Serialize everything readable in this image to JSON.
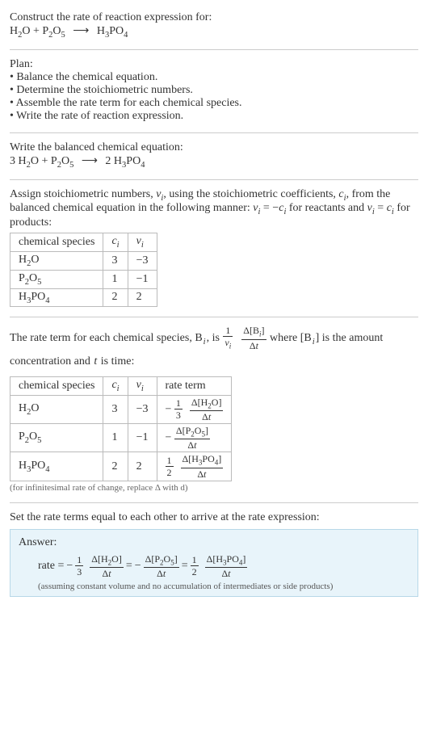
{
  "prompt": {
    "title": "Construct the rate of reaction expression for:",
    "equation_left_a": "H",
    "equation_left_a_sub": "2",
    "equation_left_b": "O + P",
    "equation_left_c_sub": "2",
    "equation_left_d": "O",
    "equation_left_e_sub": "5",
    "arrow": "⟶",
    "equation_right_a": "H",
    "equation_right_a_sub": "3",
    "equation_right_b": "PO",
    "equation_right_b_sub": "4"
  },
  "plan": {
    "heading": "Plan:",
    "items": [
      "• Balance the chemical equation.",
      "• Determine the stoichiometric numbers.",
      "• Assemble the rate term for each chemical species.",
      "• Write the rate of reaction expression."
    ]
  },
  "balanced": {
    "heading": "Write the balanced chemical equation:",
    "c1": "3 ",
    "s1a": "H",
    "s1a_sub": "2",
    "s1b": "O",
    "plus1": " + ",
    "s2a": "P",
    "s2a_sub": "2",
    "s2b": "O",
    "s2b_sub": "5",
    "arrow": "⟶",
    "c2": "2 ",
    "s3a": "H",
    "s3a_sub": "3",
    "s3b": "PO",
    "s3b_sub": "4"
  },
  "stoich": {
    "text_a": "Assign stoichiometric numbers, ",
    "nu": "ν",
    "sub_i": "i",
    "text_b": ", using the stoichiometric coefficients, ",
    "c": "c",
    "text_c": ", from the balanced chemical equation in the following manner: ",
    "rel1_a": "ν",
    "rel1_b": " = −",
    "rel1_c": "c",
    "text_d": " for reactants and ",
    "rel2_a": "ν",
    "rel2_b": " = ",
    "rel2_c": "c",
    "text_e": " for products:",
    "table": {
      "headers": {
        "species": "chemical species",
        "ci": "c",
        "ci_sub": "i",
        "nui": "ν",
        "nui_sub": "i"
      },
      "rows": [
        {
          "sp_a": "H",
          "sp_a_sub": "2",
          "sp_b": "O",
          "ci": "3",
          "nui": "−3"
        },
        {
          "sp_a": "P",
          "sp_a_sub": "2",
          "sp_b": "O",
          "sp_c_sub": "5",
          "ci": "1",
          "nui": "−1"
        },
        {
          "sp_a": "H",
          "sp_a_sub": "3",
          "sp_b": "PO",
          "sp_c_sub": "4",
          "ci": "2",
          "nui": "2"
        }
      ]
    }
  },
  "rateterm": {
    "text_a": "The rate term for each chemical species, B",
    "sub_i": "i",
    "text_b": ", is ",
    "frac1_num": "1",
    "frac1_den_a": "ν",
    "frac1_den_sub": "i",
    "frac2_num_a": "Δ[B",
    "frac2_num_sub": "i",
    "frac2_num_b": "]",
    "frac2_den_a": "Δ",
    "frac2_den_b": "t",
    "text_c": " where [B",
    "text_c2": "] is the amount concentration and ",
    "t": "t",
    "text_d": " is time:",
    "table": {
      "headers": {
        "species": "chemical species",
        "ci": "c",
        "ci_sub": "i",
        "nui": "ν",
        "nui_sub": "i",
        "rate": "rate term"
      },
      "rows": [
        {
          "sp_a": "H",
          "sp_a_sub": "2",
          "sp_b": "O",
          "ci": "3",
          "nui": "−3",
          "rt_neg": "−",
          "rt_f1_num": "1",
          "rt_f1_den": "3",
          "rt_f2_num_a": "Δ[H",
          "rt_f2_num_sub1": "2",
          "rt_f2_num_b": "O]",
          "rt_f2_den_a": "Δ",
          "rt_f2_den_b": "t"
        },
        {
          "sp_a": "P",
          "sp_a_sub": "2",
          "sp_b": "O",
          "sp_c_sub": "5",
          "ci": "1",
          "nui": "−1",
          "rt_neg": "−",
          "rt_f2_num_a": "Δ[P",
          "rt_f2_num_sub1": "2",
          "rt_f2_num_b": "O",
          "rt_f2_num_sub2": "5",
          "rt_f2_num_c": "]",
          "rt_f2_den_a": "Δ",
          "rt_f2_den_b": "t"
        },
        {
          "sp_a": "H",
          "sp_a_sub": "3",
          "sp_b": "PO",
          "sp_c_sub": "4",
          "ci": "2",
          "nui": "2",
          "rt_f1_num": "1",
          "rt_f1_den": "2",
          "rt_f2_num_a": "Δ[H",
          "rt_f2_num_sub1": "3",
          "rt_f2_num_b": "PO",
          "rt_f2_num_sub2": "4",
          "rt_f2_num_c": "]",
          "rt_f2_den_a": "Δ",
          "rt_f2_den_b": "t"
        }
      ]
    },
    "note": "(for infinitesimal rate of change, replace Δ with d)"
  },
  "final": {
    "heading": "Set the rate terms equal to each other to arrive at the rate expression:"
  },
  "answer": {
    "label": "Answer:",
    "rate_eq": "rate = ",
    "neg": "−",
    "t1_f1_num": "1",
    "t1_f1_den": "3",
    "t1_f2_num_a": "Δ[H",
    "t1_f2_num_sub": "2",
    "t1_f2_num_b": "O]",
    "t1_f2_den_a": "Δ",
    "t1_f2_den_b": "t",
    "eq": " = ",
    "t2_f2_num_a": "Δ[P",
    "t2_f2_num_sub1": "2",
    "t2_f2_num_b": "O",
    "t2_f2_num_sub2": "5",
    "t2_f2_num_c": "]",
    "t2_f2_den_a": "Δ",
    "t2_f2_den_b": "t",
    "t3_f1_num": "1",
    "t3_f1_den": "2",
    "t3_f2_num_a": "Δ[H",
    "t3_f2_num_sub1": "3",
    "t3_f2_num_b": "PO",
    "t3_f2_num_sub2": "4",
    "t3_f2_num_c": "]",
    "t3_f2_den_a": "Δ",
    "t3_f2_den_b": "t",
    "note": "(assuming constant volume and no accumulation of intermediates or side products)"
  }
}
